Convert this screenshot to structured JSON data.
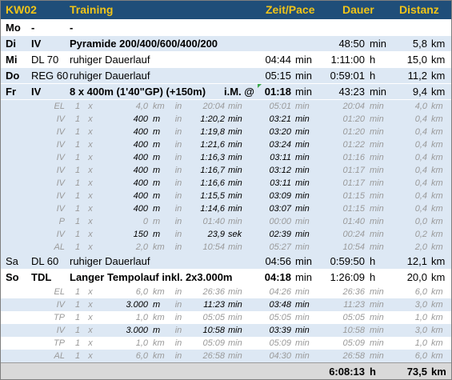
{
  "header": {
    "kw": "KW02",
    "training": "Training",
    "zeit_pace": "Zeit/Pace",
    "dauer": "Dauer",
    "distanz": "Distanz"
  },
  "days": {
    "mo": {
      "day": "Mo",
      "code": "-",
      "desc": "-"
    },
    "di": {
      "day": "Di",
      "code": "IV",
      "desc": "Pyramide 200/400/600/400/200",
      "pace": "",
      "pace_unit": "",
      "dauer": "48:50",
      "dauer_unit": "min",
      "dist": "5,8",
      "dist_unit": "km"
    },
    "mi": {
      "day": "Mi",
      "code": "DL 70",
      "desc": "ruhiger Dauerlauf",
      "pace": "04:44",
      "pace_unit": "min",
      "dauer": "1:11:00",
      "dauer_unit": "h",
      "dist": "15,0",
      "dist_unit": "km"
    },
    "do": {
      "day": "Do",
      "code": "REG 60",
      "desc": "ruhiger Dauerlauf",
      "pace": "05:15",
      "pace_unit": "min",
      "dauer": "0:59:01",
      "dauer_unit": "h",
      "dist": "11,2",
      "dist_unit": "km"
    },
    "fr": {
      "day": "Fr",
      "code": "IV",
      "desc": "8 x 400m (1'40\"GP) (+150m)",
      "note": "i.M. @",
      "pace": "01:18",
      "pace_unit": "min",
      "dauer": "43:23",
      "dauer_unit": "min",
      "dist": "9,4",
      "dist_unit": "km"
    },
    "sa": {
      "day": "Sa",
      "code": "DL 60",
      "desc": "ruhiger Dauerlauf",
      "pace": "04:56",
      "pace_unit": "min",
      "dauer": "0:59:50",
      "dauer_unit": "h",
      "dist": "12,1",
      "dist_unit": "km"
    },
    "so": {
      "day": "So",
      "code": "TDL",
      "desc": "Langer Tempolauf inkl. 2x3.000m",
      "pace": "04:18",
      "pace_unit": "min",
      "dauer": "1:26:09",
      "dauer_unit": "h",
      "dist": "20,0",
      "dist_unit": "km"
    }
  },
  "fr_details": [
    {
      "type": "EL",
      "n": "1",
      "x": "x",
      "amt": "4,0",
      "unit": "km",
      "in": "in",
      "time": "20:04",
      "tu": "min",
      "pace": "05:01",
      "pu": "min",
      "dauer": "20:04",
      "du": "min",
      "dist": "4,0",
      "dsu": "km"
    },
    {
      "type": "IV",
      "n": "1",
      "x": "x",
      "amt": "400",
      "unit": "m",
      "in": "in",
      "time": "1:20,2",
      "tu": "min",
      "pace": "03:21",
      "pu": "min",
      "dauer": "01:20",
      "du": "min",
      "dist": "0,4",
      "dsu": "km"
    },
    {
      "type": "IV",
      "n": "1",
      "x": "x",
      "amt": "400",
      "unit": "m",
      "in": "in",
      "time": "1:19,8",
      "tu": "min",
      "pace": "03:20",
      "pu": "min",
      "dauer": "01:20",
      "du": "min",
      "dist": "0,4",
      "dsu": "km"
    },
    {
      "type": "IV",
      "n": "1",
      "x": "x",
      "amt": "400",
      "unit": "m",
      "in": "in",
      "time": "1:21,6",
      "tu": "min",
      "pace": "03:24",
      "pu": "min",
      "dauer": "01:22",
      "du": "min",
      "dist": "0,4",
      "dsu": "km"
    },
    {
      "type": "IV",
      "n": "1",
      "x": "x",
      "amt": "400",
      "unit": "m",
      "in": "in",
      "time": "1:16,3",
      "tu": "min",
      "pace": "03:11",
      "pu": "min",
      "dauer": "01:16",
      "du": "min",
      "dist": "0,4",
      "dsu": "km"
    },
    {
      "type": "IV",
      "n": "1",
      "x": "x",
      "amt": "400",
      "unit": "m",
      "in": "in",
      "time": "1:16,7",
      "tu": "min",
      "pace": "03:12",
      "pu": "min",
      "dauer": "01:17",
      "du": "min",
      "dist": "0,4",
      "dsu": "km"
    },
    {
      "type": "IV",
      "n": "1",
      "x": "x",
      "amt": "400",
      "unit": "m",
      "in": "in",
      "time": "1:16,6",
      "tu": "min",
      "pace": "03:11",
      "pu": "min",
      "dauer": "01:17",
      "du": "min",
      "dist": "0,4",
      "dsu": "km"
    },
    {
      "type": "IV",
      "n": "1",
      "x": "x",
      "amt": "400",
      "unit": "m",
      "in": "in",
      "time": "1:15,5",
      "tu": "min",
      "pace": "03:09",
      "pu": "min",
      "dauer": "01:15",
      "du": "min",
      "dist": "0,4",
      "dsu": "km"
    },
    {
      "type": "IV",
      "n": "1",
      "x": "x",
      "amt": "400",
      "unit": "m",
      "in": "in",
      "time": "1:14,6",
      "tu": "min",
      "pace": "03:07",
      "pu": "min",
      "dauer": "01:15",
      "du": "min",
      "dist": "0,4",
      "dsu": "km"
    },
    {
      "type": "P",
      "n": "1",
      "x": "x",
      "amt": "0",
      "unit": "m",
      "in": "in",
      "time": "01:40",
      "tu": "min",
      "pace": "00:00",
      "pu": "min",
      "dauer": "01:40",
      "du": "min",
      "dist": "0,0",
      "dsu": "km"
    },
    {
      "type": "IV",
      "n": "1",
      "x": "x",
      "amt": "150",
      "unit": "m",
      "in": "in",
      "time": "23,9",
      "tu": "sek",
      "pace": "02:39",
      "pu": "min",
      "dauer": "00:24",
      "du": "min",
      "dist": "0,2",
      "dsu": "km"
    },
    {
      "type": "AL",
      "n": "1",
      "x": "x",
      "amt": "2,0",
      "unit": "km",
      "in": "in",
      "time": "10:54",
      "tu": "min",
      "pace": "05:27",
      "pu": "min",
      "dauer": "10:54",
      "du": "min",
      "dist": "2,0",
      "dsu": "km"
    }
  ],
  "so_details": [
    {
      "type": "EL",
      "n": "1",
      "x": "x",
      "amt": "6,0",
      "unit": "km",
      "in": "in",
      "time": "26:36",
      "tu": "min",
      "pace": "04:26",
      "pu": "min",
      "dauer": "26:36",
      "du": "min",
      "dist": "6,0",
      "dsu": "km"
    },
    {
      "type": "IV",
      "n": "1",
      "x": "x",
      "amt": "3.000",
      "unit": "m",
      "in": "in",
      "time": "11:23",
      "tu": "min",
      "pace": "03:48",
      "pu": "min",
      "dauer": "11:23",
      "du": "min",
      "dist": "3,0",
      "dsu": "km"
    },
    {
      "type": "TP",
      "n": "1",
      "x": "x",
      "amt": "1,0",
      "unit": "km",
      "in": "in",
      "time": "05:05",
      "tu": "min",
      "pace": "05:05",
      "pu": "min",
      "dauer": "05:05",
      "du": "min",
      "dist": "1,0",
      "dsu": "km"
    },
    {
      "type": "IV",
      "n": "1",
      "x": "x",
      "amt": "3.000",
      "unit": "m",
      "in": "in",
      "time": "10:58",
      "tu": "min",
      "pace": "03:39",
      "pu": "min",
      "dauer": "10:58",
      "du": "min",
      "dist": "3,0",
      "dsu": "km"
    },
    {
      "type": "TP",
      "n": "1",
      "x": "x",
      "amt": "1,0",
      "unit": "km",
      "in": "in",
      "time": "05:09",
      "tu": "min",
      "pace": "05:09",
      "pu": "min",
      "dauer": "05:09",
      "du": "min",
      "dist": "1,0",
      "dsu": "km"
    },
    {
      "type": "AL",
      "n": "1",
      "x": "x",
      "amt": "6,0",
      "unit": "km",
      "in": "in",
      "time": "26:58",
      "tu": "min",
      "pace": "04:30",
      "pu": "min",
      "dauer": "26:58",
      "du": "min",
      "dist": "6,0",
      "dsu": "km"
    }
  ],
  "total": {
    "dauer": "6:08:13",
    "dauer_unit": "h",
    "dist": "73,5",
    "dist_unit": "km"
  },
  "colors": {
    "header_bg": "#1f4e79",
    "header_text": "#f0c419",
    "row_light_blue": "#dde8f4",
    "total_bg": "#d9d9d9",
    "comment_marker": "#3aa84a"
  }
}
